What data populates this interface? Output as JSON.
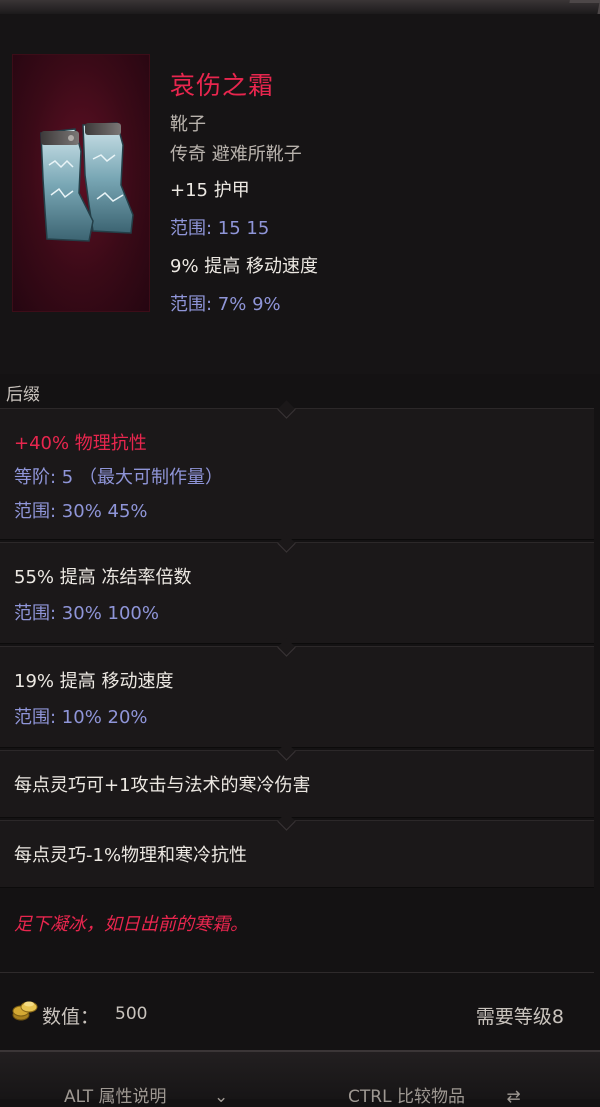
{
  "item": {
    "name": "哀伤之霜",
    "type": "靴子",
    "rarity": "传奇 避难所靴子",
    "base_stats": [
      {
        "stat": "+15 护甲",
        "range": "范围: 15  15"
      },
      {
        "stat": "9% 提高 移动速度",
        "range": "范围: 7%  9%"
      }
    ]
  },
  "section_label": "后缀",
  "affixes": [
    {
      "lines": [
        "+40% 物理抗性",
        "等阶: 5 （最大可制作量）",
        "范围: 30%  45%"
      ]
    },
    {
      "lines": [
        "55% 提高 冻结率倍数",
        "范围: 30%  100%"
      ]
    },
    {
      "lines": [
        "19% 提高 移动速度",
        "范围: 10%  20%"
      ]
    },
    {
      "lines": [
        "每点灵巧可+1攻击与法术的寒冷伤害"
      ]
    },
    {
      "lines": [
        "每点灵巧-1%物理和寒冷抗性"
      ]
    }
  ],
  "flavor_text": "足下凝冰，如日出前的寒霜。",
  "footer": {
    "value_label": "数值：",
    "value": "500",
    "required_level": "需要等级8"
  },
  "bottom_bar": {
    "alt_hint": "ALT 属性说明",
    "ctrl_hint": "CTRL 比较物品"
  },
  "colors": {
    "legendary_name": "#e8264e",
    "range_text": "#8f95d8",
    "portrait_bg": "#3a0a17"
  },
  "icons": {
    "portrait": "frost-boots-icon",
    "value": "gold-coins-icon",
    "alt_hint": "chevron-down-icon",
    "ctrl_hint": "compare-arrows-icon"
  }
}
